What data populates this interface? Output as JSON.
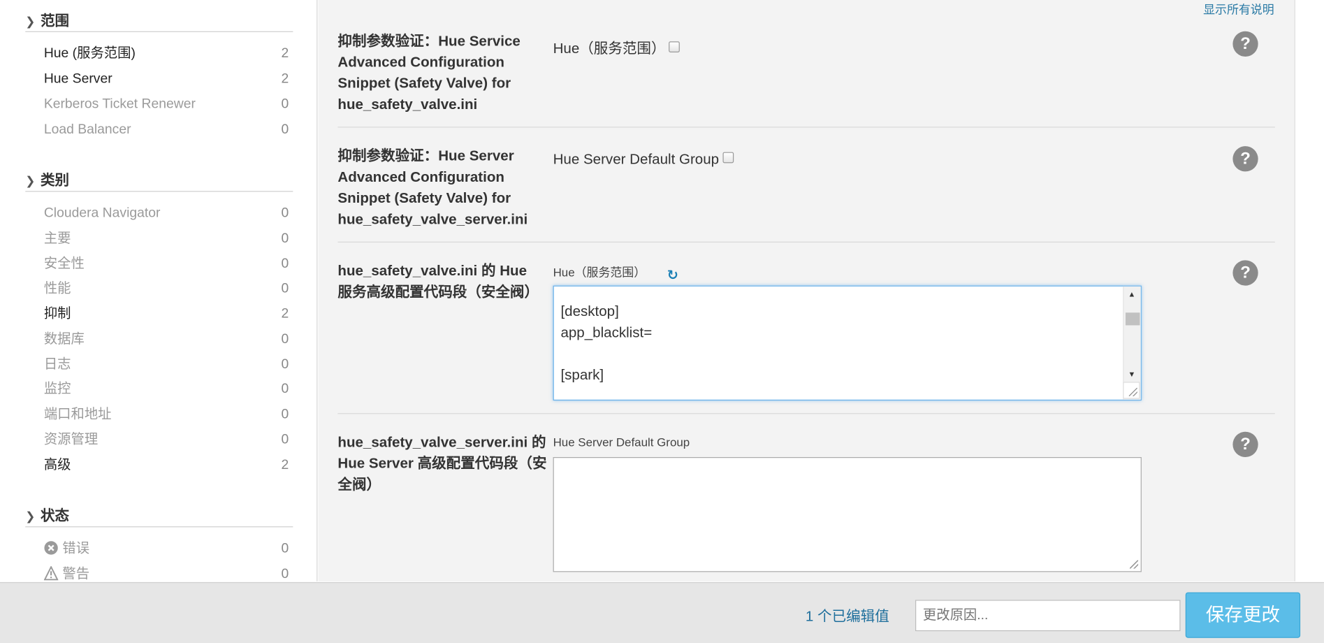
{
  "sidebar": {
    "scope": {
      "title": "范围",
      "items": [
        {
          "label": "Hue (服务范围)",
          "count": "2"
        },
        {
          "label": "Hue Server",
          "count": "2"
        },
        {
          "label": "Kerberos Ticket Renewer",
          "count": "0"
        },
        {
          "label": "Load Balancer",
          "count": "0"
        }
      ]
    },
    "category": {
      "title": "类别",
      "items": [
        {
          "label": "Cloudera Navigator",
          "count": "0"
        },
        {
          "label": "主要",
          "count": "0"
        },
        {
          "label": "安全性",
          "count": "0"
        },
        {
          "label": "性能",
          "count": "0"
        },
        {
          "label": "抑制",
          "count": "2"
        },
        {
          "label": "数据库",
          "count": "0"
        },
        {
          "label": "日志",
          "count": "0"
        },
        {
          "label": "监控",
          "count": "0"
        },
        {
          "label": "端口和地址",
          "count": "0"
        },
        {
          "label": "资源管理",
          "count": "0"
        },
        {
          "label": "高级",
          "count": "2"
        }
      ]
    },
    "status": {
      "title": "状态",
      "items": [
        {
          "label": "错误",
          "count": "0",
          "icon": "error-icon"
        },
        {
          "label": "警告",
          "count": "0",
          "icon": "warning-icon"
        }
      ]
    }
  },
  "main": {
    "show_all_link": "显示所有说明",
    "rows": [
      {
        "title": "抑制参数验证：Hue Service Advanced Configuration Snippet (Safety Valve) for hue_safety_valve.ini",
        "scope": "Hue（服务范围）"
      },
      {
        "title": "抑制参数验证：Hue Server Advanced Configuration Snippet (Safety Valve) for hue_safety_valve_server.ini",
        "scope": "Hue Server Default Group"
      },
      {
        "title": "hue_safety_valve.ini 的 Hue 服务高级配置代码段（安全阀）",
        "scope": "Hue（服务范围）",
        "textarea_lines": [
          "[desktop]",
          "app_blacklist=",
          "",
          "[spark]"
        ]
      },
      {
        "title": "hue_safety_valve_server.ini 的 Hue Server 高级配置代码段（安全阀）",
        "scope": "Hue Server Default Group",
        "textarea_lines": []
      }
    ],
    "help_glyph": "?"
  },
  "footer": {
    "edited_count": "1 个已编辑值",
    "reason_placeholder": "更改原因...",
    "save_label": "保存更改"
  },
  "colors": {
    "accent": "#5bbde8",
    "link": "#2a7aa5",
    "panel": "#f3f3f3"
  }
}
